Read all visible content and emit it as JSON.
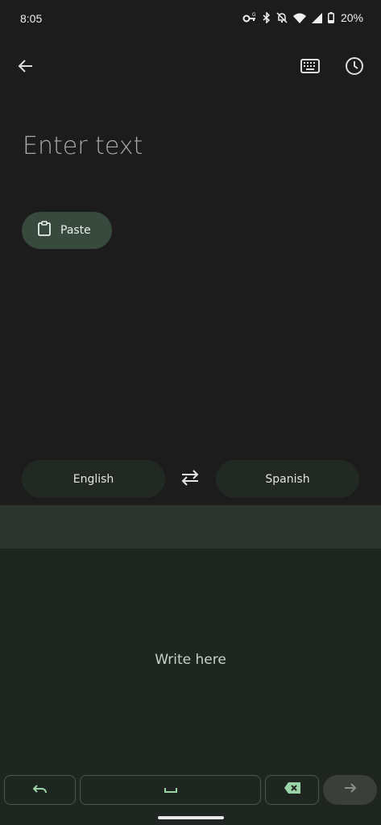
{
  "status_bar": {
    "time": "8:05",
    "battery": "20%",
    "icons": [
      "vpn-key-icon",
      "bluetooth-icon",
      "notifications-off-icon",
      "wifi-icon",
      "signal-icon",
      "battery-icon"
    ]
  },
  "app_bar": {
    "icons": [
      "back-arrow-icon",
      "keyboard-icon",
      "history-icon"
    ]
  },
  "input": {
    "placeholder": "Enter text"
  },
  "paste_chip": {
    "label": "Paste",
    "icon": "clipboard-icon"
  },
  "languages": {
    "source": "English",
    "target": "Spanish",
    "swap_icon": "swap-arrows-icon"
  },
  "handwriting": {
    "prompt": "Write here"
  },
  "keyboard_row": {
    "keys": [
      "undo-icon",
      "space-icon",
      "backspace-icon",
      "enter-arrow-icon"
    ]
  },
  "colors": {
    "background": "#1c1c1c",
    "chip": "#384a3e",
    "accent_green": "#9ad3a5",
    "handwriting_bg": "#1f2621"
  }
}
